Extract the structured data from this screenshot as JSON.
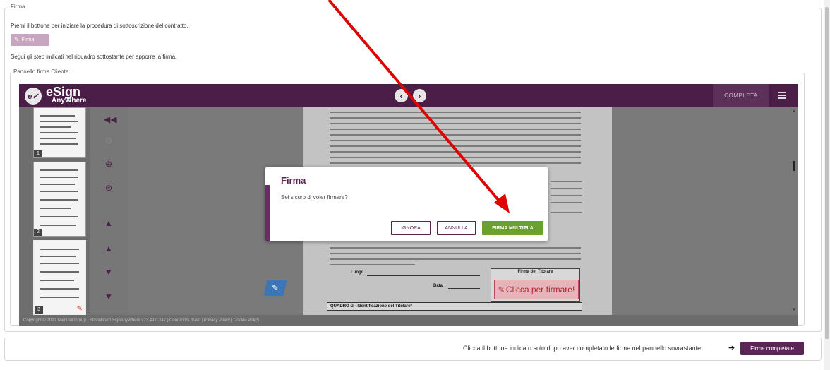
{
  "firma_section": {
    "legend": "Firma",
    "instruction": "Premi il bottone per iniziare la procedura di sottoscrizione del contratto.",
    "firma_button_label": "Firma",
    "steps_text": "Segui gli step indicati nel riquadro sottostante per apporre la firma."
  },
  "panel": {
    "legend": "Pannello firma Cliente"
  },
  "viewer": {
    "logo_main": "eSign",
    "logo_sub": "AnyWhere",
    "completa_label": "COMPLETA",
    "thumbnail_pages": [
      "1",
      "2",
      "3"
    ],
    "footer": "Copyright © 2021 Namirial Group | SIGNificant SignAnyWhere v23.49.0.247 | Condizioni d'uso | Privacy Policy | Cookie Policy",
    "signature_title": "Firma del Titolare",
    "signature_click": "Clicca per firmare!",
    "doc_luogo": "Luogo",
    "doc_data": "Data",
    "quadro_label": "QUADRO G - Identificazione del Titolare*"
  },
  "modal": {
    "title": "Firma",
    "message": "Sei sicuro di voler firmare?",
    "ignora_label": "IGNORA",
    "annulla_label": "ANNULLA",
    "firma_multipla_label": "FIRMA MULTIPLA"
  },
  "bottom": {
    "hint": "Clicca il bottone indicato solo dopo aver completato le firme nel pannello sovrastante",
    "complete_label": "Firme completate"
  },
  "colors": {
    "brand_purple": "#4b1e48",
    "confirm_green": "#6aa12d",
    "annotation_red": "#e00000"
  }
}
